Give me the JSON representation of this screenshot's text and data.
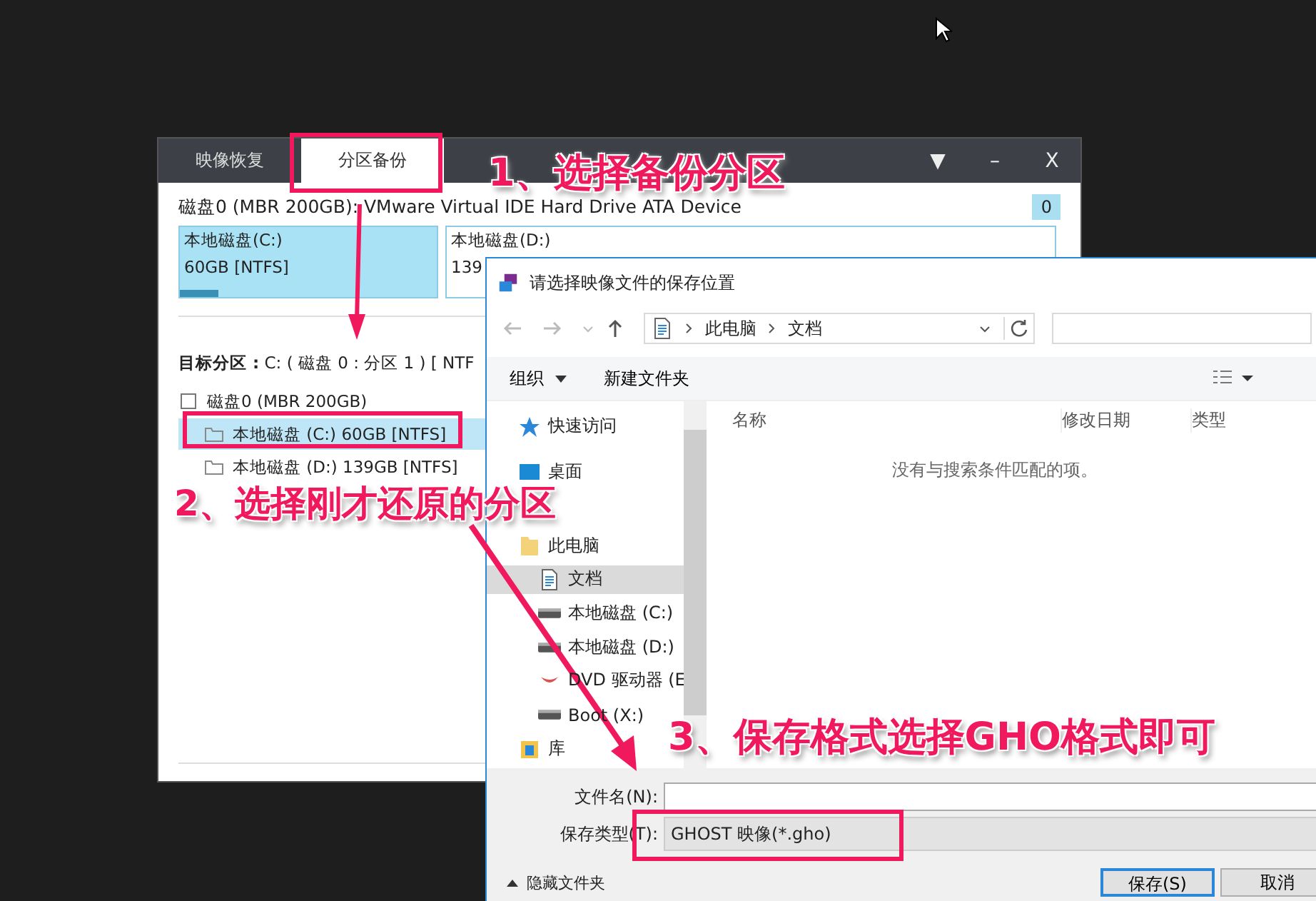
{
  "main_window": {
    "tabs": [
      {
        "label": "映像恢复",
        "selected": false
      },
      {
        "label": "分区备份",
        "selected": true
      }
    ],
    "controls": [
      "▼",
      "–",
      "X"
    ],
    "disk_title": "磁盘0 (MBR 200GB): VMware Virtual IDE Hard Drive ATA Device",
    "badge": "0",
    "partitions": [
      {
        "name": "本地磁盘(C:)",
        "size": "60GB [NTFS]",
        "selected": true,
        "level": 0.15
      },
      {
        "name": "本地磁盘(D:)",
        "size": "139",
        "selected": false
      }
    ],
    "target": "**目标分区 :** C: ( 磁盘 0 : 分区 1 ) [ NTF",
    "tree": [
      {
        "label": "磁盘0 (MBR 200GB)",
        "children": [
          {
            "label": "本地磁盘 (C:) 60GB [NTFS]",
            "selected": true
          },
          {
            "label": "本地磁盘 (D:) 139GB [NTFS]",
            "selected": false
          }
        ]
      }
    ]
  },
  "dialog": {
    "title": "请选择映像文件的保存位置",
    "path": [
      "此电脑",
      "文档"
    ],
    "toolbar": {
      "organize": "组织",
      "new_folder": "新建文件夹"
    },
    "nav": [
      {
        "label": "快速访问",
        "kind": "star",
        "selected": false
      },
      {
        "label": "桌面",
        "kind": "desktop",
        "selected": false
      },
      {
        "label": "此电脑",
        "kind": "folder",
        "selected": false,
        "children": [
          {
            "label": "文档",
            "kind": "document",
            "selected": true
          },
          {
            "label": "本地磁盘 (C:)",
            "kind": "drive",
            "selected": false
          },
          {
            "label": "本地磁盘 (D:)",
            "kind": "drive",
            "selected": false
          },
          {
            "label": "DVD 驱动器 (E",
            "kind": "dvd",
            "selected": false
          },
          {
            "label": "Boot (X:)",
            "kind": "drive",
            "selected": false
          }
        ]
      },
      {
        "label": "库",
        "kind": "library",
        "selected": false
      }
    ],
    "columns": [
      "名称",
      "修改日期",
      "类型"
    ],
    "empty_message": "没有与搜索条件匹配的项。",
    "filename_label": "文件名(N):",
    "filetype_label": "保存类型(T):",
    "filetype_value": "GHOST 映像(*.gho)",
    "hide_folders": "隐藏文件夹",
    "buttons": [
      "保存(S)",
      "取消"
    ]
  },
  "annotations": [
    "1、选择备份分区",
    "2、选择刚才还原的分区",
    "3、保存格式选择GHO格式即可"
  ]
}
